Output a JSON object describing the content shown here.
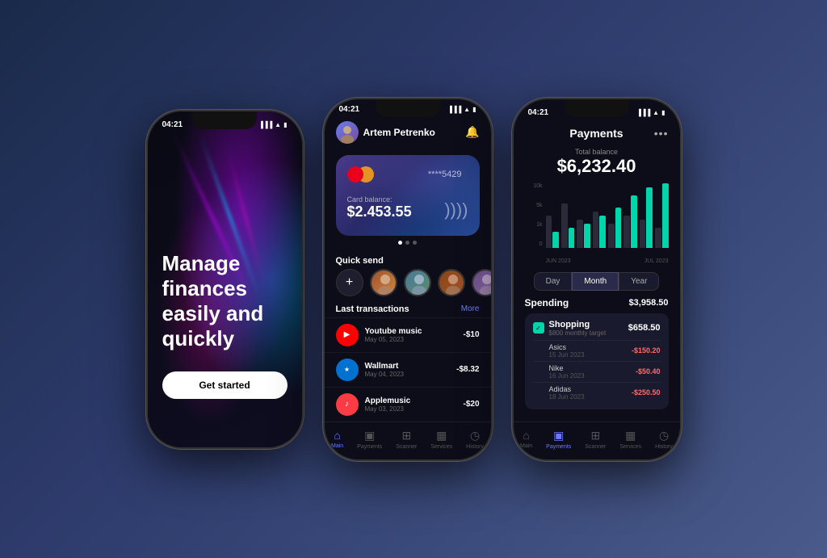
{
  "background": "#2d3a6b",
  "phone1": {
    "status_time": "04:21",
    "title_line1": "Manage",
    "title_line2": "finances",
    "title_line3": "easily and",
    "title_line4": "quickly",
    "cta_label": "Get started"
  },
  "phone2": {
    "status_time": "04:21",
    "user_name": "Artem Petrenko",
    "card_number": "****5429",
    "card_balance_label": "Card balance:",
    "card_balance": "$2.453.55",
    "quick_send_label": "Quick send",
    "add_label": "+",
    "transactions_label": "Last transactions",
    "more_label": "More",
    "transactions": [
      {
        "name": "Youtube music",
        "date": "May 05, 2023",
        "amount": "-$10",
        "icon": "▶",
        "color": "yt"
      },
      {
        "name": "Wallmart",
        "date": "May 04, 2023",
        "amount": "-$8.32",
        "icon": "★",
        "color": "wm"
      },
      {
        "name": "Applemusic",
        "date": "May 03, 2023",
        "amount": "-$20",
        "icon": "♪",
        "color": "am"
      }
    ],
    "nav_items": [
      {
        "label": "Main",
        "icon": "⌂",
        "active": true
      },
      {
        "label": "Payments",
        "icon": "💳",
        "active": false
      },
      {
        "label": "Scanner",
        "icon": "⊞",
        "active": false
      },
      {
        "label": "Services",
        "icon": "▦",
        "active": false
      },
      {
        "label": "History",
        "icon": "◷",
        "active": false
      }
    ]
  },
  "phone3": {
    "status_time": "04:21",
    "page_title": "Payments",
    "total_label": "Total balance",
    "total_amount": "$6,232.40",
    "chart": {
      "y_labels": [
        "10k",
        "5k",
        "1k",
        "0"
      ],
      "x_labels": [
        "JUN 2023",
        "JUL 2023"
      ],
      "bars": [
        {
          "gray": 40,
          "teal": 20
        },
        {
          "gray": 55,
          "teal": 25
        },
        {
          "gray": 35,
          "teal": 30
        },
        {
          "gray": 45,
          "teal": 40
        },
        {
          "gray": 30,
          "teal": 50
        },
        {
          "gray": 40,
          "teal": 65
        },
        {
          "gray": 35,
          "teal": 75
        },
        {
          "gray": 25,
          "teal": 80
        }
      ]
    },
    "period_buttons": [
      "Day",
      "Month",
      "Year"
    ],
    "active_period": "Month",
    "spending_label": "Spending",
    "spending_total": "$3,958.50",
    "category": {
      "name": "Shopping",
      "target": "$800 monthly target",
      "amount": "$658.50",
      "sub_transactions": [
        {
          "name": "Asics",
          "date": "15 Jun 2023",
          "amount": "-$150.20"
        },
        {
          "name": "Nike",
          "date": "16 Jun 2023",
          "amount": "-$50.40"
        },
        {
          "name": "Adidas",
          "date": "18 Jun 2023",
          "amount": "-$250.50"
        }
      ]
    },
    "nav_items": [
      {
        "label": "Main",
        "icon": "⌂",
        "active": false
      },
      {
        "label": "Payments",
        "icon": "💳",
        "active": true
      },
      {
        "label": "Scanner",
        "icon": "⊞",
        "active": false
      },
      {
        "label": "Services",
        "icon": "▦",
        "active": false
      },
      {
        "label": "History",
        "icon": "◷",
        "active": false
      }
    ]
  }
}
